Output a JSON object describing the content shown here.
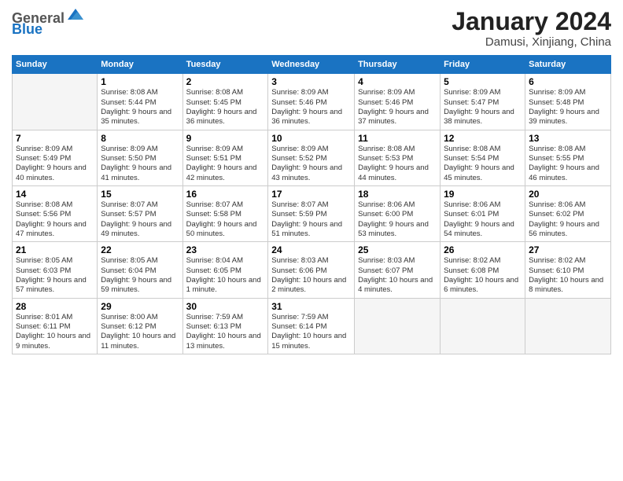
{
  "header": {
    "logo_general": "General",
    "logo_blue": "Blue",
    "title": "January 2024",
    "subtitle": "Damusi, Xinjiang, China"
  },
  "calendar": {
    "days_of_week": [
      "Sunday",
      "Monday",
      "Tuesday",
      "Wednesday",
      "Thursday",
      "Friday",
      "Saturday"
    ],
    "weeks": [
      [
        {
          "day": "",
          "sunrise": "",
          "sunset": "",
          "daylight": "",
          "empty": true
        },
        {
          "day": "1",
          "sunrise": "Sunrise: 8:08 AM",
          "sunset": "Sunset: 5:44 PM",
          "daylight": "Daylight: 9 hours and 35 minutes."
        },
        {
          "day": "2",
          "sunrise": "Sunrise: 8:08 AM",
          "sunset": "Sunset: 5:45 PM",
          "daylight": "Daylight: 9 hours and 36 minutes."
        },
        {
          "day": "3",
          "sunrise": "Sunrise: 8:09 AM",
          "sunset": "Sunset: 5:46 PM",
          "daylight": "Daylight: 9 hours and 36 minutes."
        },
        {
          "day": "4",
          "sunrise": "Sunrise: 8:09 AM",
          "sunset": "Sunset: 5:46 PM",
          "daylight": "Daylight: 9 hours and 37 minutes."
        },
        {
          "day": "5",
          "sunrise": "Sunrise: 8:09 AM",
          "sunset": "Sunset: 5:47 PM",
          "daylight": "Daylight: 9 hours and 38 minutes."
        },
        {
          "day": "6",
          "sunrise": "Sunrise: 8:09 AM",
          "sunset": "Sunset: 5:48 PM",
          "daylight": "Daylight: 9 hours and 39 minutes."
        }
      ],
      [
        {
          "day": "7",
          "sunrise": "Sunrise: 8:09 AM",
          "sunset": "Sunset: 5:49 PM",
          "daylight": "Daylight: 9 hours and 40 minutes."
        },
        {
          "day": "8",
          "sunrise": "Sunrise: 8:09 AM",
          "sunset": "Sunset: 5:50 PM",
          "daylight": "Daylight: 9 hours and 41 minutes."
        },
        {
          "day": "9",
          "sunrise": "Sunrise: 8:09 AM",
          "sunset": "Sunset: 5:51 PM",
          "daylight": "Daylight: 9 hours and 42 minutes."
        },
        {
          "day": "10",
          "sunrise": "Sunrise: 8:09 AM",
          "sunset": "Sunset: 5:52 PM",
          "daylight": "Daylight: 9 hours and 43 minutes."
        },
        {
          "day": "11",
          "sunrise": "Sunrise: 8:08 AM",
          "sunset": "Sunset: 5:53 PM",
          "daylight": "Daylight: 9 hours and 44 minutes."
        },
        {
          "day": "12",
          "sunrise": "Sunrise: 8:08 AM",
          "sunset": "Sunset: 5:54 PM",
          "daylight": "Daylight: 9 hours and 45 minutes."
        },
        {
          "day": "13",
          "sunrise": "Sunrise: 8:08 AM",
          "sunset": "Sunset: 5:55 PM",
          "daylight": "Daylight: 9 hours and 46 minutes."
        }
      ],
      [
        {
          "day": "14",
          "sunrise": "Sunrise: 8:08 AM",
          "sunset": "Sunset: 5:56 PM",
          "daylight": "Daylight: 9 hours and 47 minutes."
        },
        {
          "day": "15",
          "sunrise": "Sunrise: 8:07 AM",
          "sunset": "Sunset: 5:57 PM",
          "daylight": "Daylight: 9 hours and 49 minutes."
        },
        {
          "day": "16",
          "sunrise": "Sunrise: 8:07 AM",
          "sunset": "Sunset: 5:58 PM",
          "daylight": "Daylight: 9 hours and 50 minutes."
        },
        {
          "day": "17",
          "sunrise": "Sunrise: 8:07 AM",
          "sunset": "Sunset: 5:59 PM",
          "daylight": "Daylight: 9 hours and 51 minutes."
        },
        {
          "day": "18",
          "sunrise": "Sunrise: 8:06 AM",
          "sunset": "Sunset: 6:00 PM",
          "daylight": "Daylight: 9 hours and 53 minutes."
        },
        {
          "day": "19",
          "sunrise": "Sunrise: 8:06 AM",
          "sunset": "Sunset: 6:01 PM",
          "daylight": "Daylight: 9 hours and 54 minutes."
        },
        {
          "day": "20",
          "sunrise": "Sunrise: 8:06 AM",
          "sunset": "Sunset: 6:02 PM",
          "daylight": "Daylight: 9 hours and 56 minutes."
        }
      ],
      [
        {
          "day": "21",
          "sunrise": "Sunrise: 8:05 AM",
          "sunset": "Sunset: 6:03 PM",
          "daylight": "Daylight: 9 hours and 57 minutes."
        },
        {
          "day": "22",
          "sunrise": "Sunrise: 8:05 AM",
          "sunset": "Sunset: 6:04 PM",
          "daylight": "Daylight: 9 hours and 59 minutes."
        },
        {
          "day": "23",
          "sunrise": "Sunrise: 8:04 AM",
          "sunset": "Sunset: 6:05 PM",
          "daylight": "Daylight: 10 hours and 1 minute."
        },
        {
          "day": "24",
          "sunrise": "Sunrise: 8:03 AM",
          "sunset": "Sunset: 6:06 PM",
          "daylight": "Daylight: 10 hours and 2 minutes."
        },
        {
          "day": "25",
          "sunrise": "Sunrise: 8:03 AM",
          "sunset": "Sunset: 6:07 PM",
          "daylight": "Daylight: 10 hours and 4 minutes."
        },
        {
          "day": "26",
          "sunrise": "Sunrise: 8:02 AM",
          "sunset": "Sunset: 6:08 PM",
          "daylight": "Daylight: 10 hours and 6 minutes."
        },
        {
          "day": "27",
          "sunrise": "Sunrise: 8:02 AM",
          "sunset": "Sunset: 6:10 PM",
          "daylight": "Daylight: 10 hours and 8 minutes."
        }
      ],
      [
        {
          "day": "28",
          "sunrise": "Sunrise: 8:01 AM",
          "sunset": "Sunset: 6:11 PM",
          "daylight": "Daylight: 10 hours and 9 minutes."
        },
        {
          "day": "29",
          "sunrise": "Sunrise: 8:00 AM",
          "sunset": "Sunset: 6:12 PM",
          "daylight": "Daylight: 10 hours and 11 minutes."
        },
        {
          "day": "30",
          "sunrise": "Sunrise: 7:59 AM",
          "sunset": "Sunset: 6:13 PM",
          "daylight": "Daylight: 10 hours and 13 minutes."
        },
        {
          "day": "31",
          "sunrise": "Sunrise: 7:59 AM",
          "sunset": "Sunset: 6:14 PM",
          "daylight": "Daylight: 10 hours and 15 minutes."
        },
        {
          "day": "",
          "sunrise": "",
          "sunset": "",
          "daylight": "",
          "empty": true
        },
        {
          "day": "",
          "sunrise": "",
          "sunset": "",
          "daylight": "",
          "empty": true
        },
        {
          "day": "",
          "sunrise": "",
          "sunset": "",
          "daylight": "",
          "empty": true
        }
      ]
    ]
  }
}
